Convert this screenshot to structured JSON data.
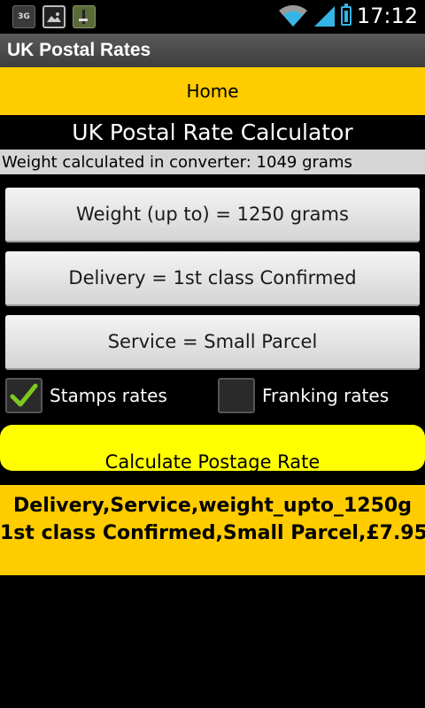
{
  "status_bar": {
    "network_label": "3G",
    "time": "17:12",
    "icons": [
      "3g-notification-icon",
      "picture-icon",
      "app-notification-icon",
      "wifi-icon",
      "signal-icon",
      "battery-icon"
    ]
  },
  "app": {
    "title": "UK Postal Rates",
    "home_label": "Home",
    "heading": "UK Postal Rate Calculator",
    "converter_info": "Weight calculated in converter: 1049 grams"
  },
  "selectors": {
    "weight": "Weight (up to) = 1250 grams",
    "delivery": "Delivery = 1st class Confirmed",
    "service": "Service = Small Parcel"
  },
  "options": {
    "stamps_label": "Stamps rates",
    "stamps_checked": true,
    "franking_label": "Franking rates",
    "franking_checked": false
  },
  "calculate_label": "Calculate Postage Rate",
  "result": {
    "line1": "Delivery,Service,weight_upto_1250g",
    "line2": "1st class Confirmed,Small Parcel,£7.95"
  },
  "colors": {
    "accent_yellow": "#ffcc00",
    "button_yellow": "#ffff00",
    "check_green": "#7ec820",
    "status_blue": "#35b5e5"
  }
}
